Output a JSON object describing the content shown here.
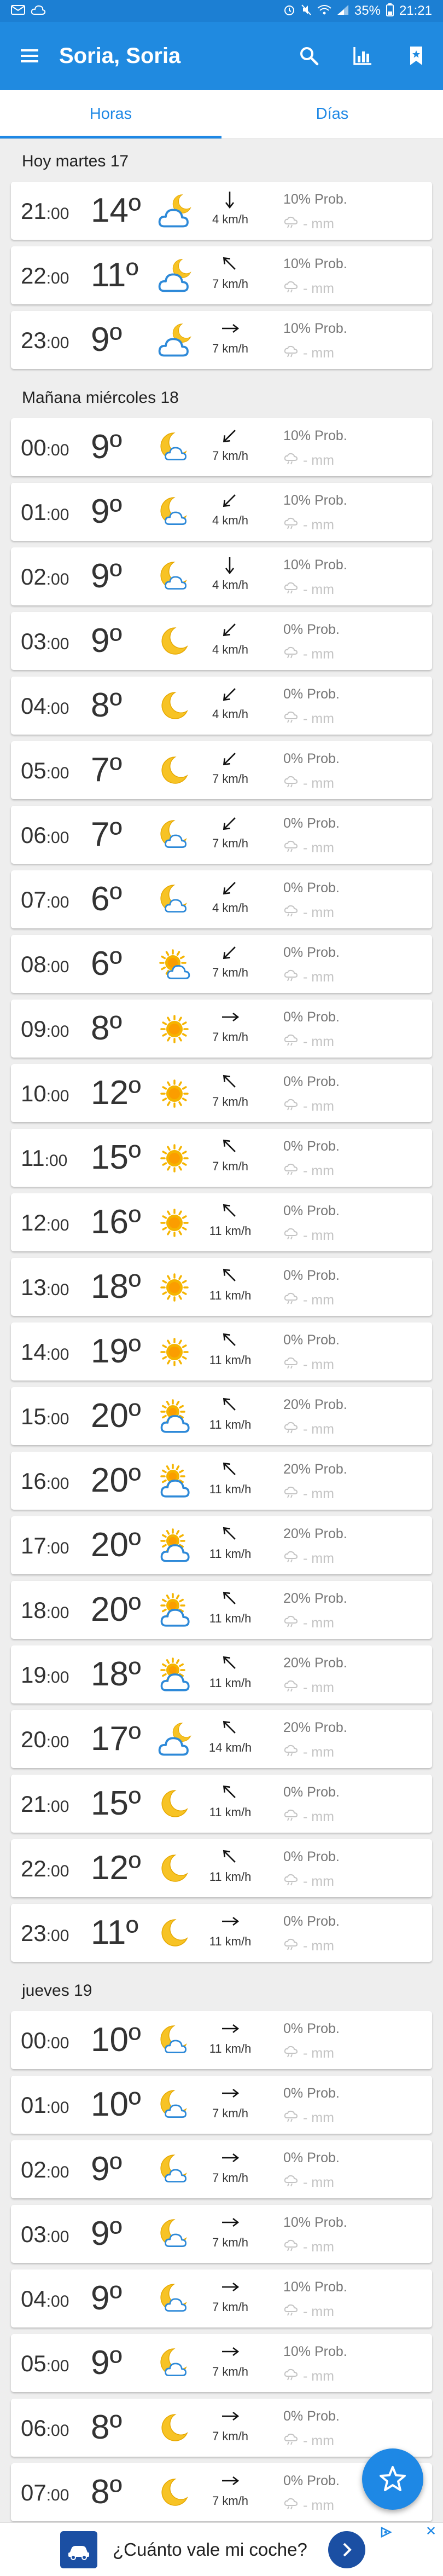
{
  "status_bar": {
    "time": "21:21",
    "battery": "35%",
    "icons": [
      "mail-icon",
      "cloud-icon",
      "alarm-icon",
      "silent-icon",
      "wifi-icon",
      "signal-icon",
      "battery-icon"
    ]
  },
  "app_bar": {
    "title": "Soria, Soria",
    "menu_icon": "menu-icon",
    "actions": [
      "search-icon",
      "chart-icon",
      "bookmark-icon"
    ]
  },
  "tabs": [
    {
      "label": "Horas",
      "active": true
    },
    {
      "label": "Días",
      "active": false
    }
  ],
  "units": {
    "temp": "º",
    "minutes": ":00"
  },
  "days": [
    {
      "label": "Hoy martes 17",
      "hours": [
        {
          "hour": "21",
          "temp": "14",
          "icon": "cloud-moon",
          "wind_dir": "S",
          "wind": "4 km/h",
          "prob": "10% Prob.",
          "rain": "- mm"
        },
        {
          "hour": "22",
          "temp": "11",
          "icon": "cloud-moon",
          "wind_dir": "NW",
          "wind": "7 km/h",
          "prob": "10% Prob.",
          "rain": "- mm"
        },
        {
          "hour": "23",
          "temp": "9",
          "icon": "cloud-moon",
          "wind_dir": "E",
          "wind": "7 km/h",
          "prob": "10% Prob.",
          "rain": "- mm"
        }
      ]
    },
    {
      "label": "Mañana miércoles 18",
      "hours": [
        {
          "hour": "00",
          "temp": "9",
          "icon": "moon-cloud",
          "wind_dir": "SW",
          "wind": "7 km/h",
          "prob": "10% Prob.",
          "rain": "- mm"
        },
        {
          "hour": "01",
          "temp": "9",
          "icon": "moon-cloud",
          "wind_dir": "SW",
          "wind": "4 km/h",
          "prob": "10% Prob.",
          "rain": "- mm"
        },
        {
          "hour": "02",
          "temp": "9",
          "icon": "moon-cloud",
          "wind_dir": "S",
          "wind": "4 km/h",
          "prob": "10% Prob.",
          "rain": "- mm"
        },
        {
          "hour": "03",
          "temp": "9",
          "icon": "moon",
          "wind_dir": "SW",
          "wind": "4 km/h",
          "prob": "0% Prob.",
          "rain": "- mm"
        },
        {
          "hour": "04",
          "temp": "8",
          "icon": "moon",
          "wind_dir": "SW",
          "wind": "4 km/h",
          "prob": "0% Prob.",
          "rain": "- mm"
        },
        {
          "hour": "05",
          "temp": "7",
          "icon": "moon",
          "wind_dir": "SW",
          "wind": "7 km/h",
          "prob": "0% Prob.",
          "rain": "- mm"
        },
        {
          "hour": "06",
          "temp": "7",
          "icon": "moon-cloud",
          "wind_dir": "SW",
          "wind": "7 km/h",
          "prob": "0% Prob.",
          "rain": "- mm"
        },
        {
          "hour": "07",
          "temp": "6",
          "icon": "moon-cloud",
          "wind_dir": "SW",
          "wind": "4 km/h",
          "prob": "0% Prob.",
          "rain": "- mm"
        },
        {
          "hour": "08",
          "temp": "6",
          "icon": "sun-cloud",
          "wind_dir": "SW",
          "wind": "7 km/h",
          "prob": "0% Prob.",
          "rain": "- mm"
        },
        {
          "hour": "09",
          "temp": "8",
          "icon": "sun",
          "wind_dir": "E",
          "wind": "7 km/h",
          "prob": "0% Prob.",
          "rain": "- mm"
        },
        {
          "hour": "10",
          "temp": "12",
          "icon": "sun",
          "wind_dir": "NW",
          "wind": "7 km/h",
          "prob": "0% Prob.",
          "rain": "- mm"
        },
        {
          "hour": "11",
          "temp": "15",
          "icon": "sun",
          "wind_dir": "NW",
          "wind": "7 km/h",
          "prob": "0% Prob.",
          "rain": "- mm"
        },
        {
          "hour": "12",
          "temp": "16",
          "icon": "sun",
          "wind_dir": "NW",
          "wind": "11 km/h",
          "prob": "0% Prob.",
          "rain": "- mm"
        },
        {
          "hour": "13",
          "temp": "18",
          "icon": "sun",
          "wind_dir": "NW",
          "wind": "11 km/h",
          "prob": "0% Prob.",
          "rain": "- mm"
        },
        {
          "hour": "14",
          "temp": "19",
          "icon": "sun",
          "wind_dir": "NW",
          "wind": "11 km/h",
          "prob": "0% Prob.",
          "rain": "- mm"
        },
        {
          "hour": "15",
          "temp": "20",
          "icon": "partly-cloudy",
          "wind_dir": "NW",
          "wind": "11 km/h",
          "prob": "20% Prob.",
          "rain": "- mm"
        },
        {
          "hour": "16",
          "temp": "20",
          "icon": "partly-cloudy",
          "wind_dir": "NW",
          "wind": "11 km/h",
          "prob": "20% Prob.",
          "rain": "- mm"
        },
        {
          "hour": "17",
          "temp": "20",
          "icon": "partly-cloudy",
          "wind_dir": "NW",
          "wind": "11 km/h",
          "prob": "20% Prob.",
          "rain": "- mm"
        },
        {
          "hour": "18",
          "temp": "20",
          "icon": "partly-cloudy",
          "wind_dir": "NW",
          "wind": "11 km/h",
          "prob": "20% Prob.",
          "rain": "- mm"
        },
        {
          "hour": "19",
          "temp": "18",
          "icon": "partly-cloudy",
          "wind_dir": "NW",
          "wind": "11 km/h",
          "prob": "20% Prob.",
          "rain": "- mm"
        },
        {
          "hour": "20",
          "temp": "17",
          "icon": "cloud-moon",
          "wind_dir": "NW",
          "wind": "14 km/h",
          "prob": "20% Prob.",
          "rain": "- mm"
        },
        {
          "hour": "21",
          "temp": "15",
          "icon": "moon",
          "wind_dir": "NW",
          "wind": "11 km/h",
          "prob": "0% Prob.",
          "rain": "- mm"
        },
        {
          "hour": "22",
          "temp": "12",
          "icon": "moon",
          "wind_dir": "NW",
          "wind": "11 km/h",
          "prob": "0% Prob.",
          "rain": "- mm"
        },
        {
          "hour": "23",
          "temp": "11",
          "icon": "moon",
          "wind_dir": "E",
          "wind": "11 km/h",
          "prob": "0% Prob.",
          "rain": "- mm"
        }
      ]
    },
    {
      "label": "jueves 19",
      "hours": [
        {
          "hour": "00",
          "temp": "10",
          "icon": "moon-cloud",
          "wind_dir": "E",
          "wind": "11 km/h",
          "prob": "0% Prob.",
          "rain": "- mm"
        },
        {
          "hour": "01",
          "temp": "10",
          "icon": "moon-cloud",
          "wind_dir": "E",
          "wind": "7 km/h",
          "prob": "0% Prob.",
          "rain": "- mm"
        },
        {
          "hour": "02",
          "temp": "9",
          "icon": "moon-cloud",
          "wind_dir": "E",
          "wind": "7 km/h",
          "prob": "0% Prob.",
          "rain": "- mm"
        },
        {
          "hour": "03",
          "temp": "9",
          "icon": "moon-cloud",
          "wind_dir": "E",
          "wind": "7 km/h",
          "prob": "10% Prob.",
          "rain": "- mm"
        },
        {
          "hour": "04",
          "temp": "9",
          "icon": "moon-cloud",
          "wind_dir": "E",
          "wind": "7 km/h",
          "prob": "10% Prob.",
          "rain": "- mm"
        },
        {
          "hour": "05",
          "temp": "9",
          "icon": "moon-cloud",
          "wind_dir": "E",
          "wind": "7 km/h",
          "prob": "10% Prob.",
          "rain": "- mm"
        },
        {
          "hour": "06",
          "temp": "8",
          "icon": "moon",
          "wind_dir": "E",
          "wind": "7 km/h",
          "prob": "0% Prob.",
          "rain": "- mm"
        },
        {
          "hour": "07",
          "temp": "8",
          "icon": "moon",
          "wind_dir": "E",
          "wind": "7 km/h",
          "prob": "0% Prob.",
          "rain": "- mm"
        }
      ]
    }
  ],
  "fab": {
    "icon": "star-icon"
  },
  "ad": {
    "text": "¿Cuánto vale mi coche?",
    "close": "✕",
    "logo_icon": "car-logo-icon",
    "go_icon": "chevron-right-icon"
  },
  "colors": {
    "primary": "#208ae0",
    "status_bar": "#1c7fd3",
    "tab_accent": "#1e88e5",
    "sun": "#f5b400",
    "sun_core": "#ff8a00",
    "moon": "#f7c325",
    "cloud_stroke": "#2d89d8",
    "background": "#eeeeee"
  }
}
